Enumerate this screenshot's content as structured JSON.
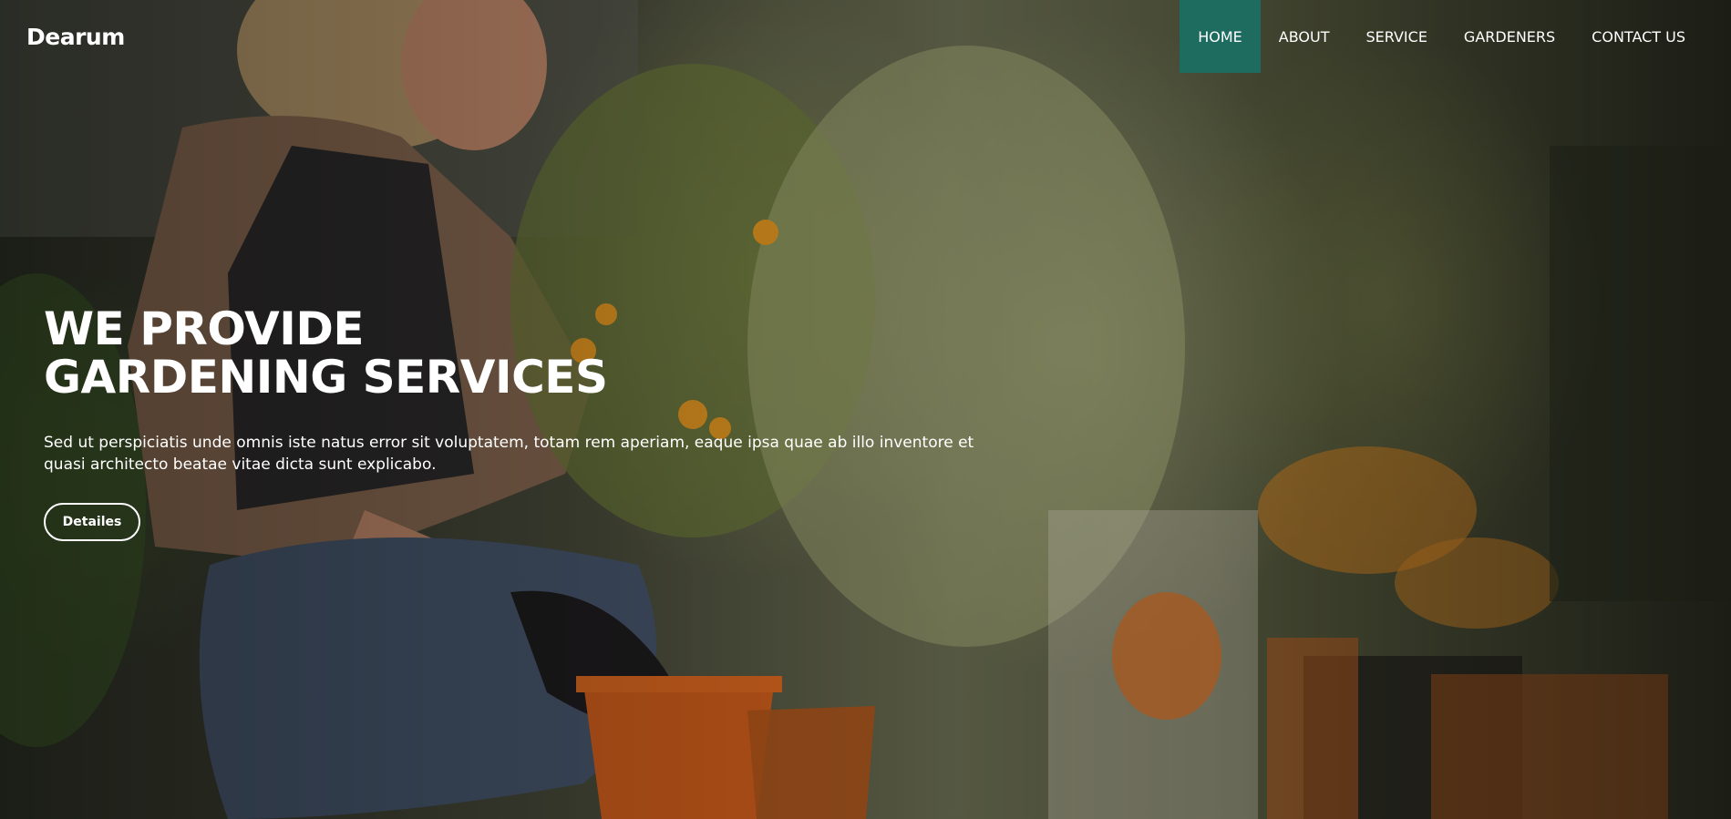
{
  "brand": {
    "name": "Dearum"
  },
  "nav": {
    "items": [
      {
        "label": "HOME",
        "active": true
      },
      {
        "label": "ABOUT",
        "active": false
      },
      {
        "label": "SERVICE",
        "active": false
      },
      {
        "label": "GARDENERS",
        "active": false
      },
      {
        "label": "CONTACT US",
        "active": false
      }
    ]
  },
  "hero": {
    "title_line1": "WE PROVIDE",
    "title_line2": "GARDENING SERVICES",
    "description": "Sed ut perspiciatis unde omnis iste natus error sit voluptatem, totam rem aperiam, eaque ipsa quae ab illo inventore et quasi architecto beatae vitae dicta sunt explicabo.",
    "button_label": "Detailes"
  },
  "colors": {
    "accent": "#1e6b5f",
    "text": "#ffffff"
  }
}
